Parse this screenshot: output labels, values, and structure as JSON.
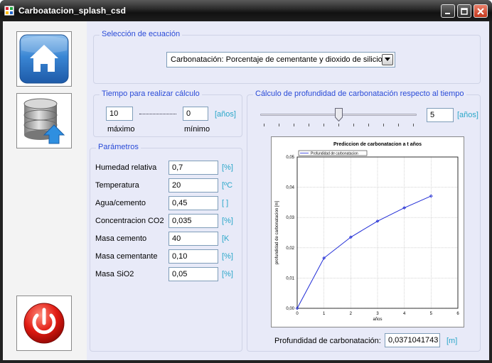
{
  "window": {
    "title": "Carboatacion_splash_csd"
  },
  "sidebar": {
    "home_icon": "home-icon",
    "db_icon": "database-upload-icon",
    "power_icon": "power-icon"
  },
  "ecuacion": {
    "legend": "Selección de ecuación",
    "selected": "Carbonatación: Porcentaje de cementante y dioxido de silicio"
  },
  "tiempo": {
    "legend": "Tiempo para realizar cálculo",
    "max_value": "10",
    "min_value": "0",
    "max_label": "máximo",
    "min_label": "mínimo",
    "unit": "[años]"
  },
  "parametros": {
    "legend": "Parámetros",
    "rows": [
      {
        "label": "Humedad relativa",
        "value": "0,7",
        "unit": "[%]"
      },
      {
        "label": "Temperatura",
        "value": "20",
        "unit": "[ºC"
      },
      {
        "label": "Agua/cemento",
        "value": "0,45",
        "unit": "[ ]"
      },
      {
        "label": "Concentracion CO2",
        "value": "0,035",
        "unit": "[%]"
      },
      {
        "label": "Masa cemento",
        "value": "40",
        "unit": "[K"
      },
      {
        "label": "Masa cementante",
        "value": "0,10",
        "unit": "[%]"
      },
      {
        "label": "Masa SiO2",
        "value": "0,05",
        "unit": "[%]"
      }
    ]
  },
  "calculo": {
    "legend": "Cálculo de profundidad de carbonatación respecto al tiempo",
    "slider_value": 5,
    "slider_min": 0,
    "slider_max": 10,
    "time_value": "5",
    "unit": "[años]",
    "result_label": "Profundidad de carbonatación:",
    "result_value": "0,0371041743",
    "result_unit": "[m]"
  },
  "chart_data": {
    "type": "line",
    "title": "Prediccion de carbonatacion a t años",
    "xlabel": "años",
    "ylabel": "profundidad de carbonatacion [m]",
    "xlim": [
      0,
      6
    ],
    "ylim": [
      0,
      0.05
    ],
    "x_ticks": [
      "0",
      "1",
      "2",
      "3",
      "4",
      "5",
      "6"
    ],
    "y_ticks": [
      "0,00",
      "0,01",
      "0,02",
      "0,03",
      "0,04",
      "0,05"
    ],
    "grid": true,
    "legend_position": "top-left",
    "series": [
      {
        "name": "Profundidad de carbonatacion",
        "color": "#1f2bd6",
        "x": [
          0,
          1,
          2,
          3,
          4,
          5
        ],
        "y": [
          0,
          0.0166,
          0.0235,
          0.0288,
          0.0332,
          0.0371
        ]
      }
    ]
  }
}
